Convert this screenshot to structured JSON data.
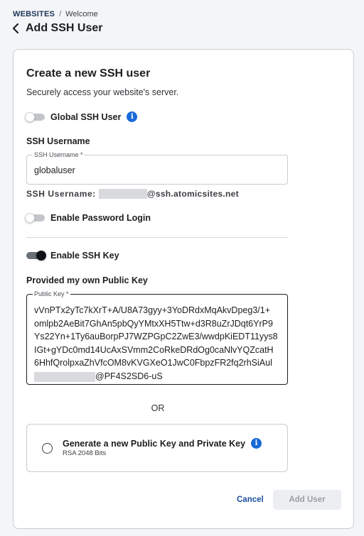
{
  "breadcrumb": {
    "parent": "WEBSITES",
    "separator": "/",
    "current": "Welcome"
  },
  "page": {
    "title": "Add SSH User"
  },
  "form": {
    "title": "Create a new SSH user",
    "subtitle": "Securely access your website's server.",
    "global_toggle": {
      "label": "Global SSH User",
      "enabled": false
    },
    "username_section": "SSH Username",
    "username_field": {
      "legend": "SSH Username *",
      "value": "globaluser"
    },
    "username_preview": {
      "label": "SSH Username:",
      "domain": "@ssh.atomicsites.net"
    },
    "password_toggle": {
      "label": "Enable Password Login",
      "enabled": false
    },
    "ssh_key_toggle": {
      "label": "Enable SSH Key",
      "enabled": true
    },
    "own_key_section": "Provided my own Public Key",
    "public_key_field": {
      "legend": "Public Key *",
      "lines": [
        "vVnPTx2yTc7kXrT+A/U8A73gyy+3YoDRdxMqAkvDpeg3/1+",
        "omlpb2AeBit7GhAn5pbQyYMtxXH5Ttw+d3R8uZrJDqt6YrP9",
        "Ys22Yn+1Ty6auBorpPJ7WZPGpC2ZwE3/wwdpKiEDT11yys8",
        "IGt+gYDc0md14UcAxSVmm2CoRkeDRdOg0caNlvYQZcatH",
        "6HhfQrolpxaZhVfcOM8vKVGXeO1JwC0FbpzFR2fq2rhSiAul"
      ],
      "last_line_suffix": "@PF4S2SD6-uS"
    },
    "or_text": "OR",
    "generate_option": {
      "title": "Generate a new Public Key and Private Key",
      "subtitle": "RSA 2048 Bits"
    },
    "cancel_label": "Cancel",
    "add_label": "Add User"
  },
  "colors": {
    "accent": "#1a6ad6",
    "link": "#1a4fa0",
    "disabled_bg": "#eceef1"
  }
}
